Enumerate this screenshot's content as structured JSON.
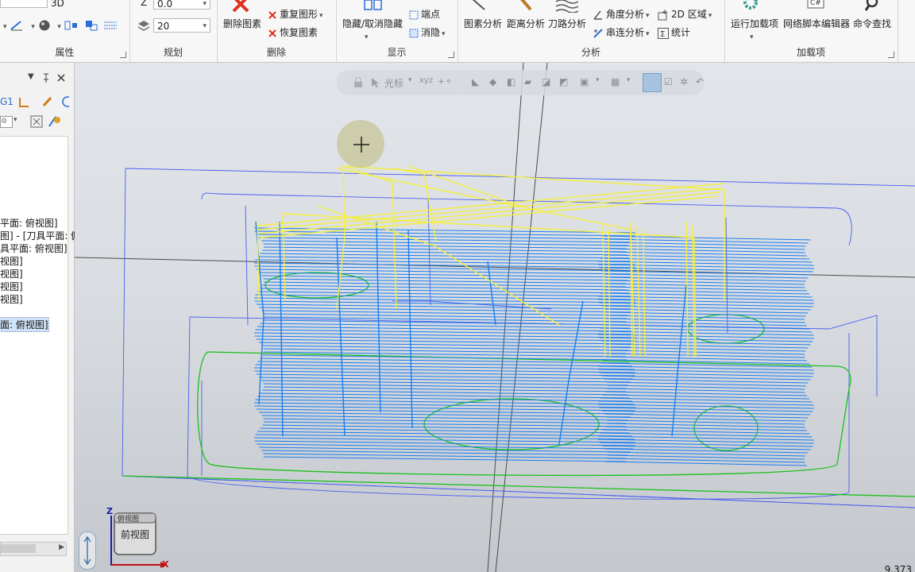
{
  "ribbon": {
    "attributes": {
      "label": "属性",
      "mode_3d": "3D"
    },
    "planning": {
      "label": "规划",
      "z_label": "Z",
      "z_value": "0.0",
      "layer_value": "20"
    },
    "delete": {
      "label": "删除",
      "delete_entity": "删除图素",
      "repeat_shape": "重复图形",
      "restore_entity": "恢复图素"
    },
    "display": {
      "label": "显示",
      "hide_unhide": "隐藏/取消隐藏",
      "endpoint": "端点",
      "blank": "消隐"
    },
    "analysis": {
      "label": "分析",
      "entity_analysis": "图素分析",
      "distance_analysis": "距离分析",
      "toolpath_analysis": "刀路分析",
      "angle_analysis": "角度分析",
      "chain_analysis": "串连分析",
      "area_2d": "2D 区域",
      "statistics": "统计"
    },
    "addins": {
      "label": "加载项",
      "run_addin": "运行加载项",
      "net_script_editor": "网络脚本编辑器",
      "command_finder": "命令查找"
    }
  },
  "left_panel": {
    "toolbar_code": "G1",
    "tree_items": [
      {
        "label": "平面: 俯视图]",
        "selected": false
      },
      {
        "label": "图] - [刀具平面: 俯",
        "selected": false
      },
      {
        "label": "具平面: 俯视图]",
        "selected": false
      },
      {
        "label": "视图]",
        "selected": false
      },
      {
        "label": "视图]",
        "selected": false
      },
      {
        "label": "视图]",
        "selected": false
      },
      {
        "label": "视图]",
        "selected": false
      },
      {
        "label": "面: 俯视图]",
        "selected": true
      }
    ]
  },
  "viewport": {
    "float_toolbar_label": "光标",
    "viewcube_top": "俯视图",
    "viewcube_label": "前视图",
    "axis_z": "Z",
    "axis_x": "X",
    "coordinate": "9.373"
  },
  "colors": {
    "wireframe": "#4a5cf0",
    "toolpath_cut": "#1a7cf0",
    "toolpath_rapid": "#f4ee3a",
    "boundary": "#1bc01b",
    "axis_line": "#4a4a4a"
  }
}
